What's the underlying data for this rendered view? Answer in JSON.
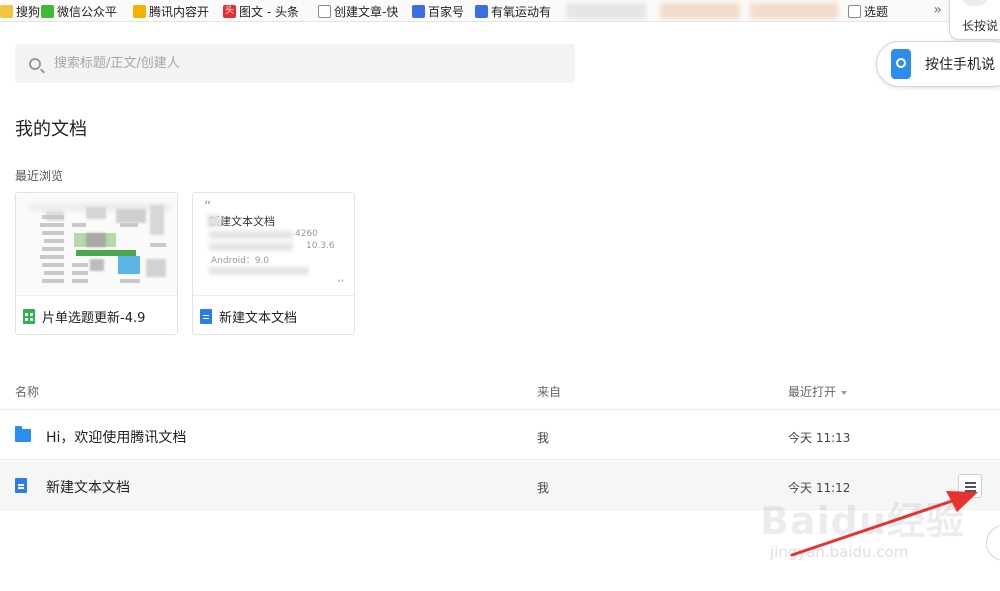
{
  "bookmarks": [
    {
      "label": "搜狗",
      "icon": "sogou-icon"
    },
    {
      "label": "微信公众平",
      "icon": "wechat-icon"
    },
    {
      "label": "腾讯内容开",
      "icon": "bell-icon"
    },
    {
      "label": "图文 - 头条",
      "icon": "toutiao-icon",
      "glyph": "头"
    },
    {
      "label": "创建文章-快",
      "icon": "page-icon"
    },
    {
      "label": "百家号",
      "icon": "paw-icon"
    },
    {
      "label": "有氧运动有",
      "icon": "paw-icon"
    },
    {
      "label": "选题",
      "icon": "page-icon"
    }
  ],
  "bookmarks_more": "»",
  "widgets": {
    "long_press": "长按说",
    "hold_phone": "按住手机说"
  },
  "search": {
    "placeholder": "搜索标题/正文/创建人"
  },
  "page_title": "我的文档",
  "recent_label": "最近浏览",
  "recent_cards": [
    {
      "name": "片单选题更新-4.9",
      "type": "sheet"
    },
    {
      "name": "新建文本文档",
      "type": "doc",
      "preview": {
        "title": "新建文本文档",
        "lines": [
          "4260",
          "10.3.6",
          "Android：9.0"
        ]
      }
    }
  ],
  "table": {
    "headers": {
      "name": "名称",
      "from": "来自",
      "opened": "最近打开"
    },
    "rows": [
      {
        "name": "Hi，欢迎使用腾讯文档",
        "type": "folder",
        "from": "我",
        "opened": "今天 11:13"
      },
      {
        "name": "新建文本文档",
        "type": "doc",
        "from": "我",
        "opened": "今天 11:12"
      }
    ]
  },
  "watermark": {
    "main": "Baidu经验",
    "sub": "jingyan.baidu.com"
  },
  "colors": {
    "accent": "#2b7de9",
    "sheet": "#2fb34e",
    "annotation": "#e8322f"
  }
}
